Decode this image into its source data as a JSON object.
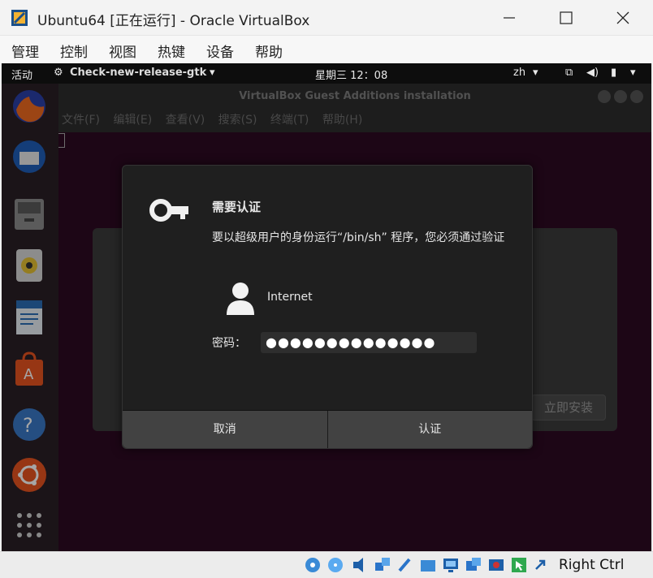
{
  "window": {
    "title": "Ubuntu64 [正在运行] - Oracle VirtualBox"
  },
  "menubar": [
    "管理",
    "控制",
    "视图",
    "热键",
    "设备",
    "帮助"
  ],
  "gnome": {
    "activities": "活动",
    "app_name": "Check-new-release-gtk",
    "clock": "星期三 12：08",
    "lang": "zh"
  },
  "terminal": {
    "title": "VirtualBox Guest Additions installation",
    "menu": [
      "文件(F)",
      "编辑(E)",
      "查看(V)",
      "搜索(S)",
      "终端(T)",
      "帮助(H)"
    ]
  },
  "updater": {
    "install_button": "立即安装"
  },
  "auth_dialog": {
    "title": "需要认证",
    "message": "要以超级用户的身份运行“/bin/sh” 程序，您必须通过验证",
    "user": "Internet",
    "password_label": "密码：",
    "password_value": "●●●●●●●●●●●●●●",
    "cancel": "取消",
    "authenticate": "认证"
  },
  "statusbar": {
    "host_key": "Right Ctrl"
  }
}
